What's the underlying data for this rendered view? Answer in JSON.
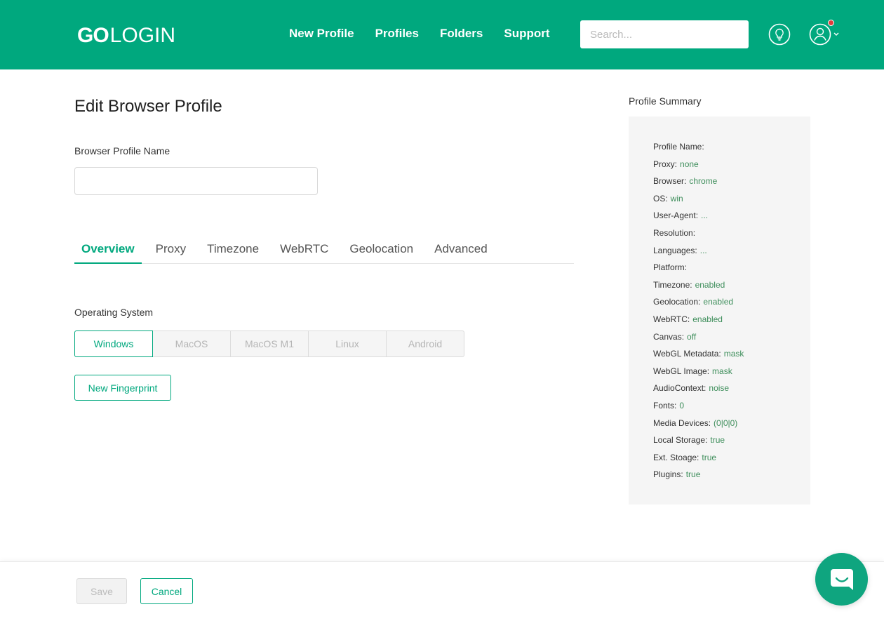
{
  "header": {
    "logo_go": "GO",
    "logo_login": "LOGIN",
    "nav": [
      "New Profile",
      "Profiles",
      "Folders",
      "Support"
    ],
    "search_placeholder": "Search..."
  },
  "main": {
    "title": "Edit Browser Profile",
    "profile_name_label": "Browser Profile Name",
    "profile_name_value": "",
    "tabs": [
      "Overview",
      "Proxy",
      "Timezone",
      "WebRTC",
      "Geolocation",
      "Advanced"
    ],
    "active_tab": "Overview",
    "os_label": "Operating System",
    "os_options": [
      "Windows",
      "MacOS",
      "MacOS M1",
      "Linux",
      "Android"
    ],
    "os_selected": "Windows",
    "new_fingerprint_label": "New Fingerprint"
  },
  "summary": {
    "title": "Profile Summary",
    "rows": [
      {
        "key": "Profile Name:",
        "value": ""
      },
      {
        "key": "Proxy:",
        "value": "none"
      },
      {
        "key": "Browser:",
        "value": "chrome"
      },
      {
        "key": "OS:",
        "value": "win"
      },
      {
        "key": "User-Agent:",
        "value": "..."
      },
      {
        "key": "Resolution:",
        "value": ""
      },
      {
        "key": "Languages:",
        "value": "..."
      },
      {
        "key": "Platform:",
        "value": ""
      },
      {
        "key": "Timezone:",
        "value": "enabled"
      },
      {
        "key": "Geolocation:",
        "value": "enabled"
      },
      {
        "key": "WebRTC:",
        "value": "enabled"
      },
      {
        "key": "Canvas:",
        "value": "off"
      },
      {
        "key": "WebGL Metadata:",
        "value": "mask"
      },
      {
        "key": "WebGL Image:",
        "value": "mask"
      },
      {
        "key": "AudioContext:",
        "value": "noise"
      },
      {
        "key": "Fonts:",
        "value": "0"
      },
      {
        "key": "Media Devices:",
        "value": "(0|0|0)"
      },
      {
        "key": "Local Storage:",
        "value": "true"
      },
      {
        "key": "Ext. Stoage:",
        "value": "true"
      },
      {
        "key": "Plugins:",
        "value": "true"
      }
    ]
  },
  "footer": {
    "save_label": "Save",
    "cancel_label": "Cancel"
  },
  "colors": {
    "brand": "#00a87e",
    "summary_value": "#3e8e5b",
    "notification": "#e23b3b"
  },
  "icons": {
    "bulb": "lightbulb-icon",
    "user": "user-icon",
    "chat": "chat-icon"
  }
}
